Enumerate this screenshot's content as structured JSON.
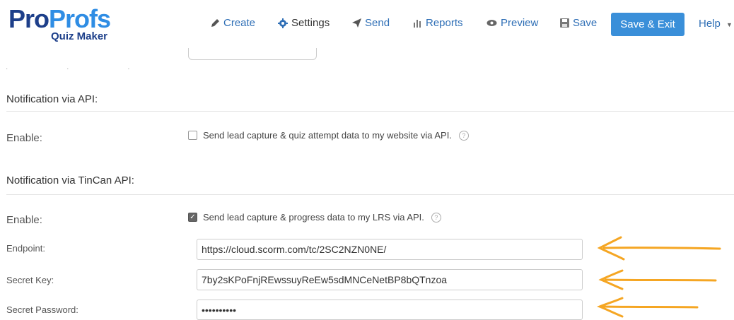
{
  "logo": {
    "word_part1": "Pro",
    "word_part2": "P",
    "word_part3": "rofs",
    "subtitle": "Quiz Maker"
  },
  "nav": {
    "create": "Create",
    "settings": "Settings",
    "send": "Send",
    "reports": "Reports",
    "preview": "Preview",
    "save": "Save",
    "save_exit": "Save & Exit",
    "help": "Help"
  },
  "api_section": {
    "title": "Notification via API:",
    "enable_label": "Enable:",
    "checkbox_label": "Send lead capture & quiz attempt data to my website via API.",
    "checked": false
  },
  "tincan_section": {
    "title": "Notification via TinCan API:",
    "enable_label": "Enable:",
    "checkbox_label": "Send lead capture & progress data to my LRS via API.",
    "checked": true,
    "endpoint_label": "Endpoint:",
    "endpoint_value": "https://cloud.scorm.com/tc/2SC2NZN0NE/",
    "secret_key_label": "Secret Key:",
    "secret_key_value": "7by2sKPoFnjREwssuyReEw5sdMNCeNetBP8bQTnzoa",
    "secret_password_label": "Secret Password:",
    "secret_password_value": "••••••••••"
  },
  "colors": {
    "accent": "#3a8fd9",
    "brand_dark": "#1d3f8a",
    "annotation_arrow": "#f5a623"
  }
}
